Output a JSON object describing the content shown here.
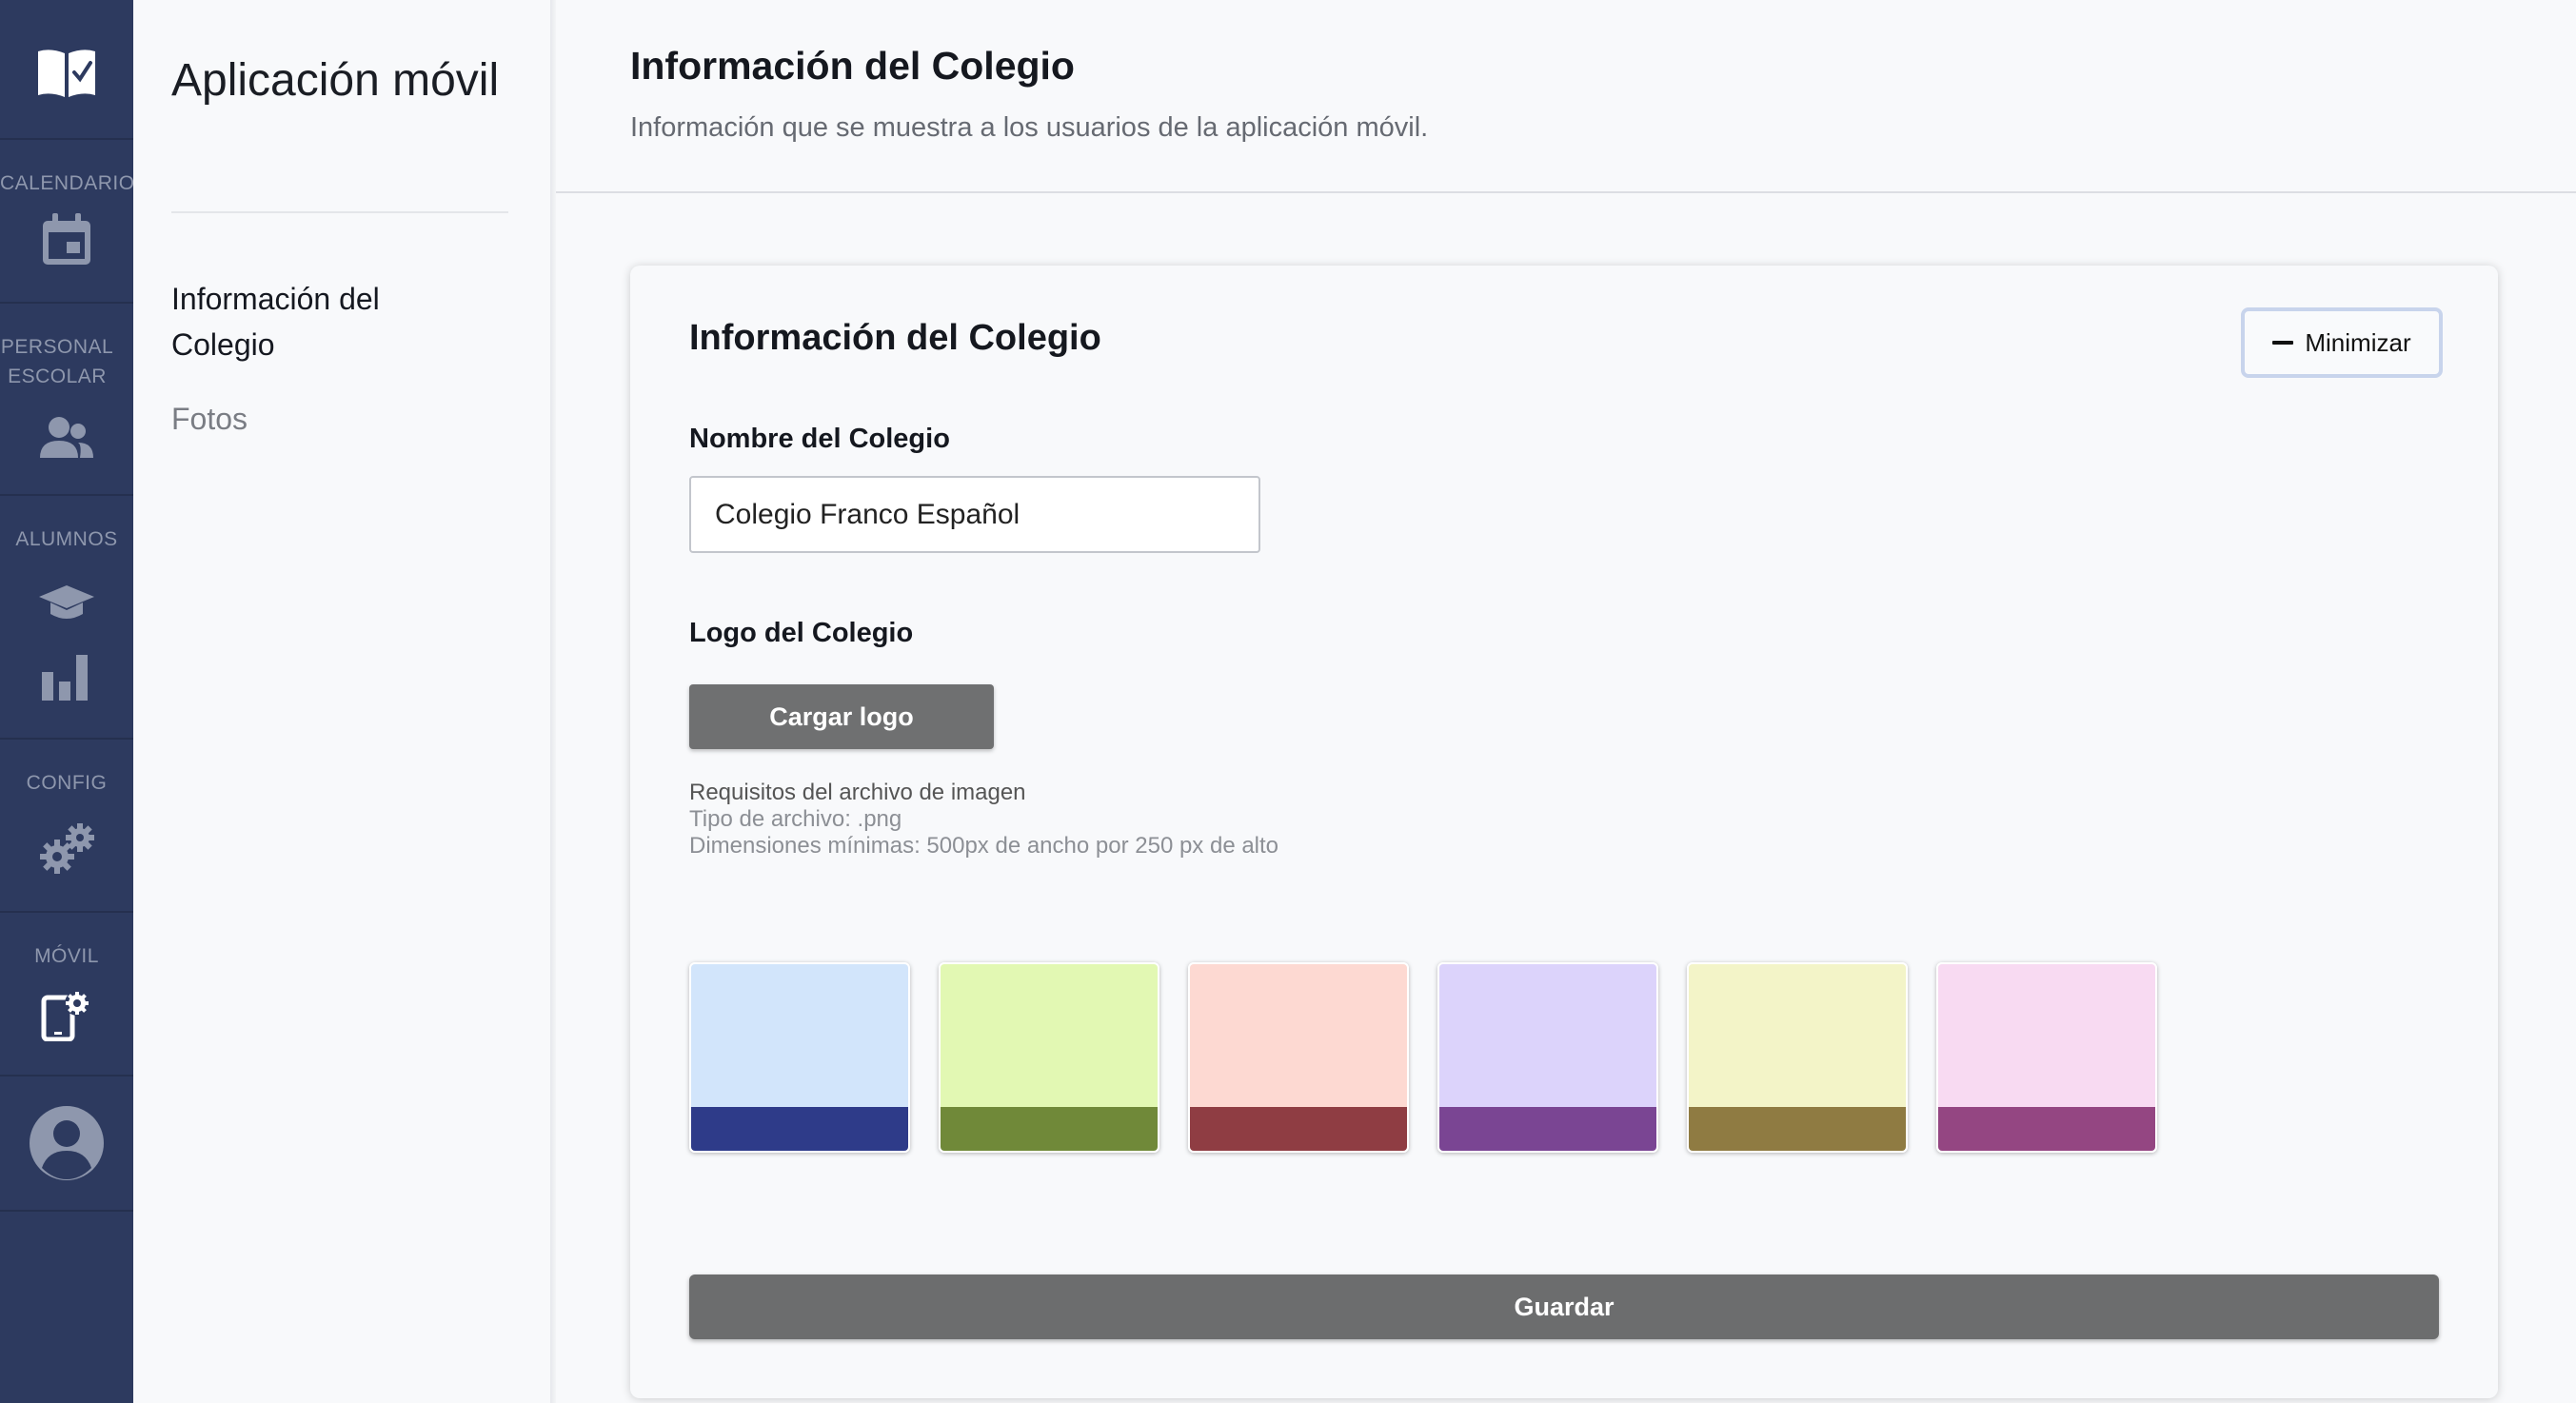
{
  "sidebar": {
    "sections": [
      {
        "label": "",
        "icon": "book-check-icon"
      },
      {
        "label": "CALENDARIO",
        "icon": "calendar-icon"
      },
      {
        "label": "PERSONAL ESCOLAR",
        "icon": "people-icon"
      },
      {
        "label": "ALUMNOS",
        "icon": "graduation-cap-icon",
        "icon2": "bar-chart-icon"
      },
      {
        "label": "CONFIG",
        "icon": "gears-icon"
      },
      {
        "label": "MÓVIL",
        "icon": "mobile-settings-icon",
        "active": true
      },
      {
        "label": "",
        "icon": "user-avatar-icon"
      }
    ],
    "colors": {
      "background": "#2d3a5f",
      "icon": "#8e97ad",
      "active_icon": "#ffffff"
    }
  },
  "subnav": {
    "title": "Aplicación móvil",
    "items": [
      {
        "label": "Información del Colegio",
        "active": true
      },
      {
        "label": "Fotos",
        "active": false
      }
    ]
  },
  "header": {
    "title": "Información del Colegio",
    "subtitle": "Información que se muestra a los usuarios de la aplicación móvil."
  },
  "card": {
    "title": "Información del Colegio",
    "minimize_label": "Minimizar",
    "name_field": {
      "label": "Nombre del Colegio",
      "value": "Colegio Franco Español"
    },
    "logo": {
      "label": "Logo del Colegio",
      "upload_label": "Cargar logo",
      "requirements_title": "Requisitos del archivo de imagen",
      "file_type": "Tipo de archivo: .png",
      "dimensions": "Dimensiones mínimas: 500px de ancho por 250 px de alto"
    },
    "themes": [
      {
        "light": "#d2e5fb",
        "dark": "#2e3b89"
      },
      {
        "light": "#e2f8b3",
        "dark": "#708939"
      },
      {
        "light": "#fdd9d2",
        "dark": "#8f3d43"
      },
      {
        "light": "#dcd3fb",
        "dark": "#7a4593"
      },
      {
        "light": "#f3f4c8",
        "dark": "#8f7b42"
      },
      {
        "light": "#f8daf2",
        "dark": "#944682"
      }
    ],
    "save_label": "Guardar"
  }
}
